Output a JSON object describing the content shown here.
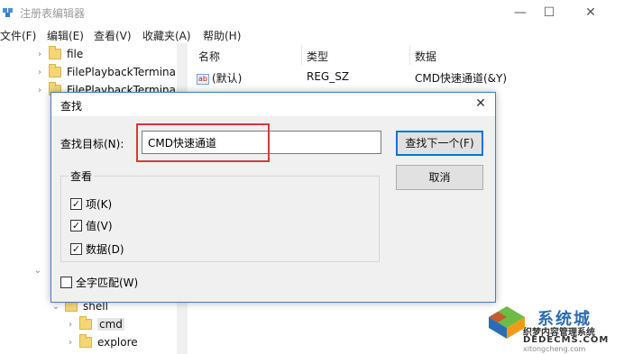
{
  "window": {
    "title": "注册表编辑器",
    "minimize": "—",
    "maximize": "☐",
    "close": "✕"
  },
  "menu": [
    "文件(F)",
    "编辑(E)",
    "查看(V)",
    "收藏夹(A)",
    "帮助(H)"
  ],
  "tree": {
    "items": [
      {
        "label": "file"
      },
      {
        "label": "FilePlaybackTermina"
      },
      {
        "label": "FilePlaybackTermina"
      },
      {
        "label": "shell"
      },
      {
        "label": "cmd"
      },
      {
        "label": "explore"
      }
    ]
  },
  "values": {
    "headers": [
      "名称",
      "类型",
      "数据"
    ],
    "rows": [
      {
        "name": "(默认)",
        "type": "REG_SZ",
        "data": "CMD快速通道(&Y)",
        "icon": "ab"
      }
    ]
  },
  "dialog": {
    "title": "查找",
    "close": "✕",
    "find_label": "查找目标(N):",
    "find_value": "CMD快速通道",
    "find_next": "查找下一个(F)",
    "cancel": "取消",
    "group_title": "查看",
    "checkboxes": [
      {
        "label": "项(K)",
        "checked": true
      },
      {
        "label": "值(V)",
        "checked": true
      },
      {
        "label": "数据(D)",
        "checked": true
      }
    ],
    "match_whole": {
      "label": "全字匹配(W)",
      "checked": false
    }
  },
  "watermark": {
    "line1": "系统城",
    "line2": "织梦内容管理系统",
    "line3": "DEDECMS.COM",
    "line4": "xitongcheng.com",
    "colors": {
      "blue": "#2a6db5",
      "green": "#5cb531",
      "orange": "#f19a1a",
      "red": "#e0402a"
    }
  },
  "colors": {
    "accent": "#0078d7",
    "highlight_box": "#d33a3a",
    "dialog_border": "#4a7bbd"
  }
}
